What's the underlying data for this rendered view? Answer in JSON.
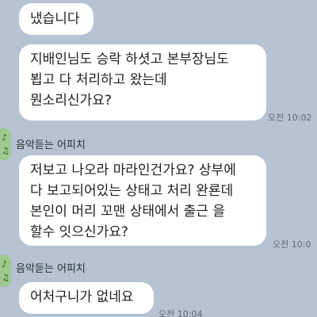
{
  "messages": [
    {
      "lines": [
        "냈습니다"
      ]
    },
    {
      "lines": [
        "지배인님도 승락 하셧고 본부장님도",
        "뵙고 다 처리하고 왔는데",
        "뭔소리신가요?"
      ],
      "time": "오전 10:02"
    },
    {
      "sender": "음악듣는 어피치",
      "lines": [
        "저보고 나오라 마라인건가요? 상부에",
        "다 보고되어있는 상태고 처리 완룐데",
        "본인이 머리 꼬맨 상태에서 출근 을",
        "할수 잇으신가요?"
      ],
      "time": "오전 10:0"
    },
    {
      "sender": "음악듣는 어피치",
      "lines": [
        "어처구니가 없네요"
      ],
      "time": "오전 10:04"
    }
  ],
  "icons": {
    "avatar": "music-note-icon"
  },
  "colors": {
    "background": "#b6c3d2",
    "bubble": "#ffffff",
    "avatar": "#9ec98c"
  }
}
